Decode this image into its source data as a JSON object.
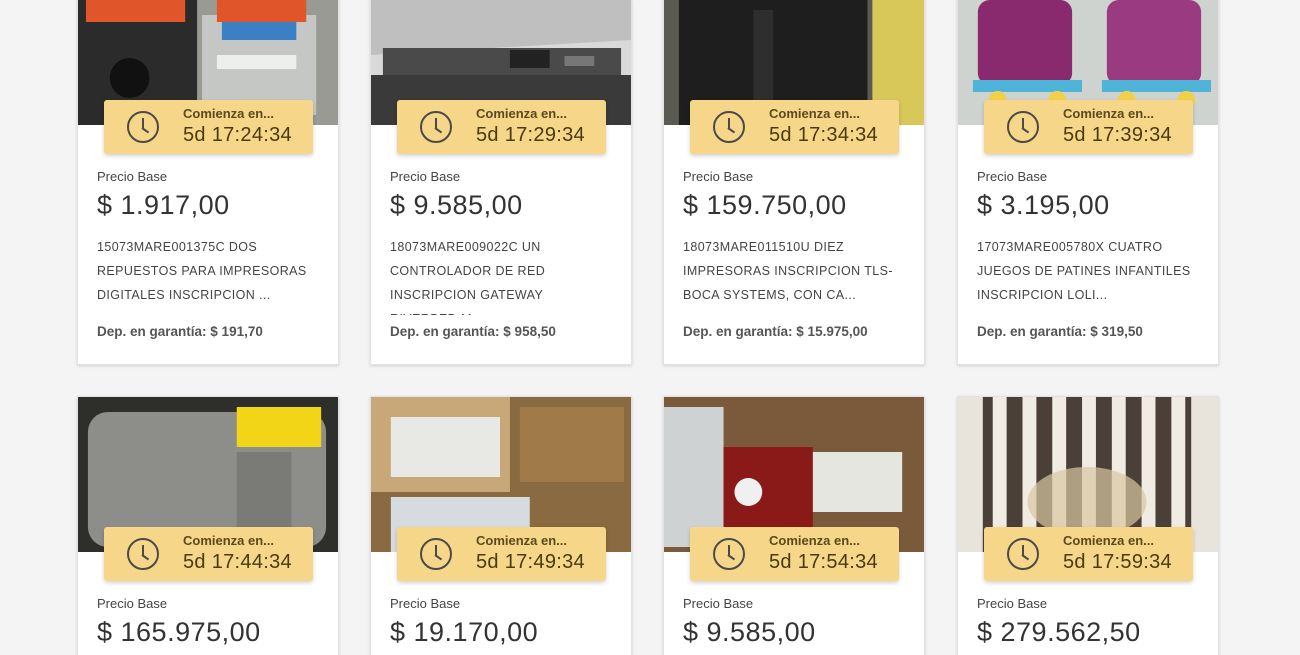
{
  "timer_label": "Comienza en...",
  "price_label": "Precio Base",
  "deposit_label": "Dep. en garantía:",
  "accent_color": "#f6d688",
  "lots": [
    {
      "countdown": "5d 17:24:34",
      "price": "$ 1.917,00",
      "description": "15073MARE001375C DOS REPUESTOS PARA IMPRESORAS DIGITALES INSCRIPCION ...",
      "deposit": "$ 191,70",
      "image": "printer-parts"
    },
    {
      "countdown": "5d 17:29:34",
      "price": "$ 9.585,00",
      "description": "18073MARE009022C UN CONTROLADOR DE RED INSCRIPCION GATEWAY RIVERBED M...",
      "deposit": "$ 958,50",
      "image": "network-controller"
    },
    {
      "countdown": "5d 17:34:34",
      "price": "$ 159.750,00",
      "description": "18073MARE011510U DIEZ IMPRESORAS INSCRIPCION TLS-BOCA SYSTEMS, CON CA...",
      "deposit": "$ 15.975,00",
      "image": "printers"
    },
    {
      "countdown": "5d 17:39:34",
      "price": "$ 3.195,00",
      "description": "17073MARE005780X CUATRO JUEGOS DE PATINES INFANTILES INSCRIPCION LOLI...",
      "deposit": "$ 319,50",
      "image": "roller-skates"
    },
    {
      "countdown": "5d 17:44:34",
      "price": "$ 165.975,00",
      "image": "dyson-dryer"
    },
    {
      "countdown": "5d 17:49:34",
      "price": "$ 19.170,00",
      "image": "cables-box"
    },
    {
      "countdown": "5d 17:54:34",
      "price": "$ 9.585,00",
      "image": "comstation-device"
    },
    {
      "countdown": "5d 17:59:34",
      "price": "$ 279.562,50",
      "image": "striped-fabric"
    }
  ]
}
